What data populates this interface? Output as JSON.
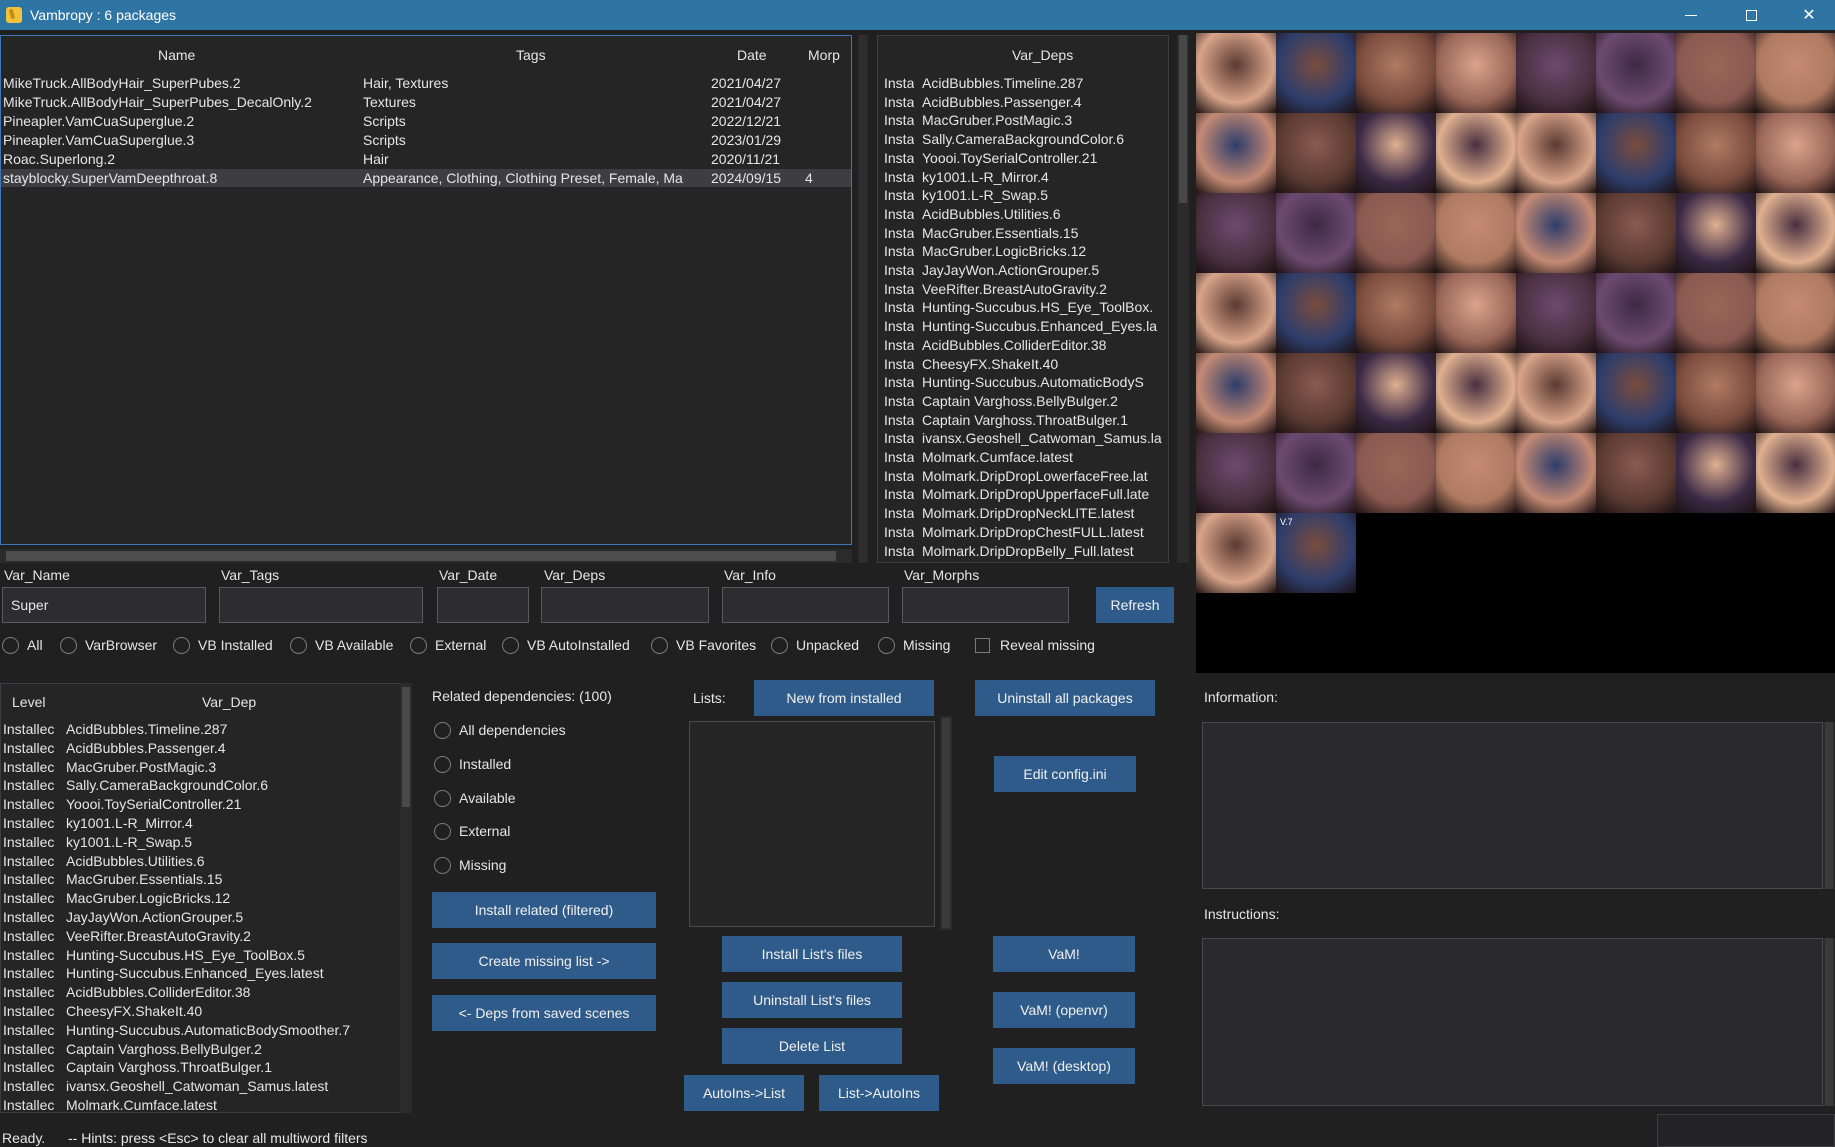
{
  "window": {
    "title": "Vambropy : 6 packages",
    "minimize_icon": "minimize-icon",
    "maximize_icon": "maximize-icon",
    "close_icon": "close-icon"
  },
  "packages_table": {
    "headers": {
      "name": "Name",
      "tags": "Tags",
      "date": "Date",
      "morphs": "Morp"
    },
    "rows": [
      {
        "name": "MikeTruck.AllBodyHair_SuperPubes.2",
        "tags": "Hair, Textures",
        "date": "2021/04/27",
        "morphs": ""
      },
      {
        "name": "MikeTruck.AllBodyHair_SuperPubes_DecalOnly.2",
        "tags": "Textures",
        "date": "2021/04/27",
        "morphs": ""
      },
      {
        "name": "Pineapler.VamCuaSuperglue.2",
        "tags": "Scripts",
        "date": "2022/12/21",
        "morphs": ""
      },
      {
        "name": "Pineapler.VamCuaSuperglue.3",
        "tags": "Scripts",
        "date": "2023/01/29",
        "morphs": ""
      },
      {
        "name": "Roac.Superlong.2",
        "tags": "Hair",
        "date": "2020/11/21",
        "morphs": ""
      },
      {
        "name": "stayblocky.SuperVamDeepthroat.8",
        "tags": "Appearance, Clothing, Clothing Preset, Female, Ma",
        "date": "2024/09/15",
        "morphs": "4"
      }
    ]
  },
  "var_deps_table": {
    "header": "Var_Deps",
    "prefix": "Insta",
    "rows": [
      "AcidBubbles.Timeline.287",
      "AcidBubbles.Passenger.4",
      "MacGruber.PostMagic.3",
      "Sally.CameraBackgroundColor.6",
      "Yoooi.ToySerialController.21",
      "ky1001.L-R_Mirror.4",
      "ky1001.L-R_Swap.5",
      "AcidBubbles.Utilities.6",
      "MacGruber.Essentials.15",
      "MacGruber.LogicBricks.12",
      "JayJayWon.ActionGrouper.5",
      "VeeRifter.BreastAutoGravity.2",
      "Hunting-Succubus.HS_Eye_ToolBox.",
      "Hunting-Succubus.Enhanced_Eyes.la",
      "AcidBubbles.ColliderEditor.38",
      "CheesyFX.ShakeIt.40",
      "Hunting-Succubus.AutomaticBodyS",
      "Captain Varghoss.BellyBulger.2",
      "Captain Varghoss.ThroatBulger.1",
      "ivansx.Geoshell_Catwoman_Samus.la",
      "Molmark.Cumface.latest",
      "Molmark.DripDropLowerfaceFree.lat",
      "Molmark.DripDropUpperfaceFull.late",
      "Molmark.DripDropNeckLITE.latest",
      "Molmark.DripDropChestFULL.latest",
      "Molmark.DripDropBelly_Full.latest"
    ]
  },
  "preview": {
    "overlay_label": "V.7"
  },
  "filters": {
    "labels": {
      "var_name": "Var_Name",
      "var_tags": "Var_Tags",
      "var_date": "Var_Date",
      "var_deps": "Var_Deps",
      "var_info": "Var_Info",
      "var_morphs": "Var_Morphs"
    },
    "values": {
      "var_name": "Super",
      "var_tags": "",
      "var_date": "",
      "var_deps": "",
      "var_info": "",
      "var_morphs": ""
    },
    "refresh": "Refresh",
    "scope": [
      "All",
      "VarBrowser",
      "VB Installed",
      "VB Available",
      "External",
      "VB AutoInstalled",
      "VB Favorites",
      "Unpacked",
      "Missing"
    ],
    "reveal_missing": "Reveal missing"
  },
  "dep_table": {
    "headers": {
      "level": "Level",
      "var_dep": "Var_Dep"
    },
    "level_value": "Installec",
    "rows": [
      "AcidBubbles.Timeline.287",
      "AcidBubbles.Passenger.4",
      "MacGruber.PostMagic.3",
      "Sally.CameraBackgroundColor.6",
      "Yoooi.ToySerialController.21",
      "ky1001.L-R_Mirror.4",
      "ky1001.L-R_Swap.5",
      "AcidBubbles.Utilities.6",
      "MacGruber.Essentials.15",
      "MacGruber.LogicBricks.12",
      "JayJayWon.ActionGrouper.5",
      "VeeRifter.BreastAutoGravity.2",
      "Hunting-Succubus.HS_Eye_ToolBox.5",
      "Hunting-Succubus.Enhanced_Eyes.latest",
      "AcidBubbles.ColliderEditor.38",
      "CheesyFX.ShakeIt.40",
      "Hunting-Succubus.AutomaticBodySmoother.7",
      "Captain Varghoss.BellyBulger.2",
      "Captain Varghoss.ThroatBulger.1",
      "ivansx.Geoshell_Catwoman_Samus.latest",
      "Molmark.Cumface.latest"
    ]
  },
  "related": {
    "title": "Related dependencies: (100)",
    "options": [
      "All dependencies",
      "Installed",
      "Available",
      "External",
      "Missing"
    ],
    "install_related": "Install related (filtered)",
    "create_missing": "Create missing list ->",
    "deps_from_scenes": "<- Deps from saved scenes"
  },
  "lists": {
    "label": "Lists:",
    "new_from_installed": "New from installed",
    "install_files": "Install List's files",
    "uninstall_files": "Uninstall List's files",
    "delete_list": "Delete List",
    "autoins_to_list": "AutoIns->List",
    "list_to_autoins": "List->AutoIns"
  },
  "actions": {
    "uninstall_all": "Uninstall all packages",
    "edit_config": "Edit config.ini",
    "vam": "VaM!",
    "vam_openvr": "VaM! (openvr)",
    "vam_desktop": "VaM! (desktop)"
  },
  "info": {
    "information": "Information:",
    "instructions": "Instructions:"
  },
  "status": {
    "state": "Ready.",
    "hint": "-- Hints: press <Esc> to clear all multiword filters"
  }
}
